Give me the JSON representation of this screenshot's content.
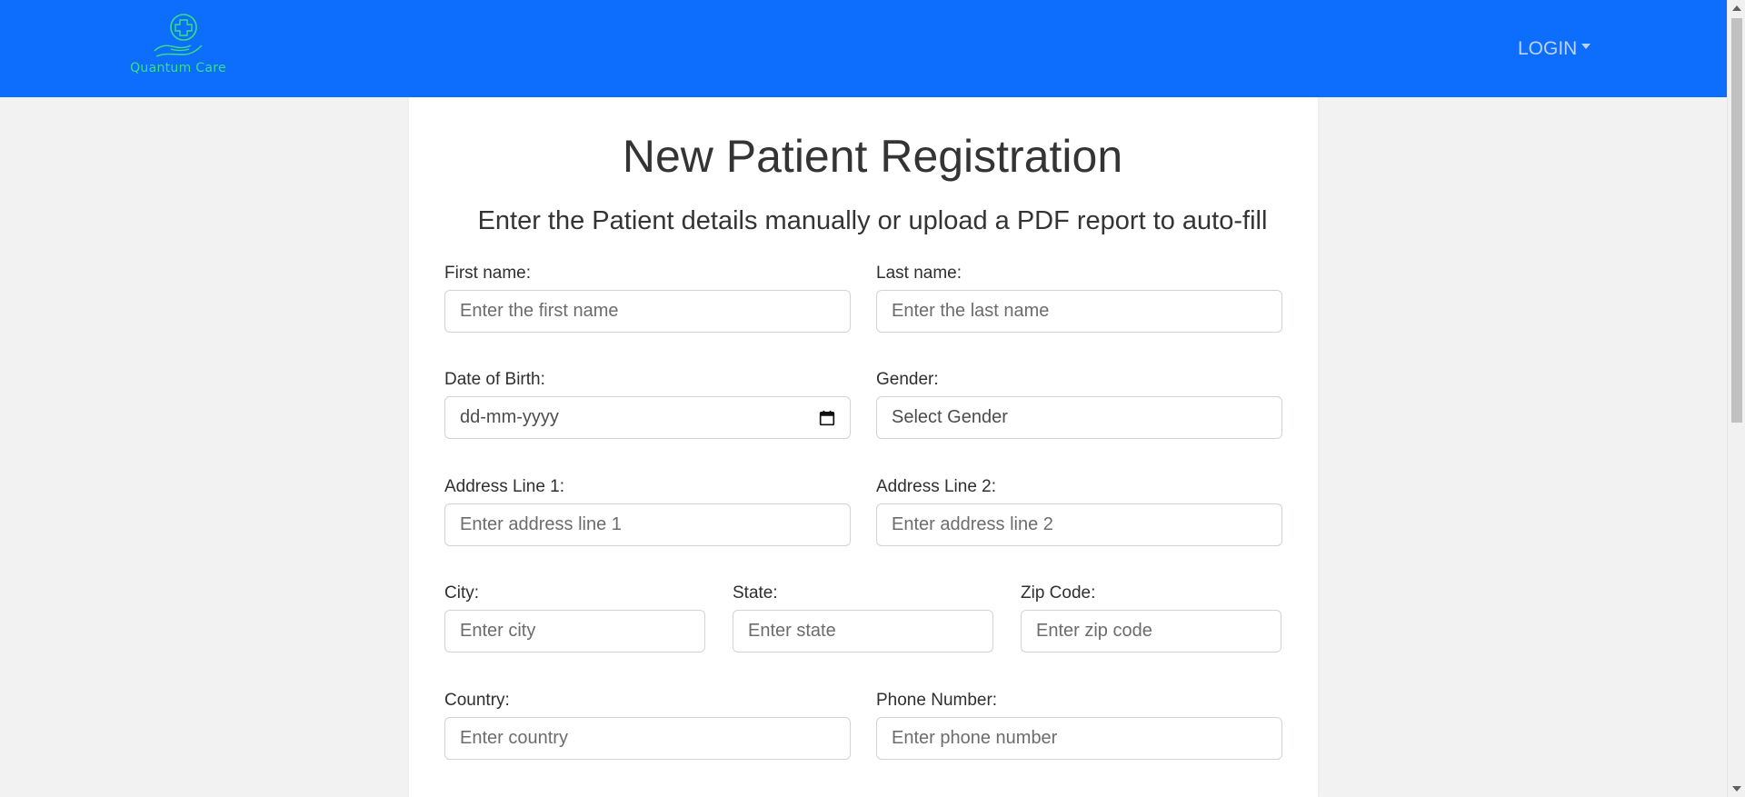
{
  "navbar": {
    "brand_name": "Quantum Care",
    "logo_icon": "hand-with-medical-cross-icon",
    "login_label": "LOGIN",
    "colors": {
      "background": "#0d6efd",
      "brand_text": "#39e07c"
    }
  },
  "page": {
    "title": "New Patient Registration",
    "subtitle": "Enter the Patient details manually or upload a PDF report to auto-fill"
  },
  "form": {
    "first_name": {
      "label": "First name:",
      "placeholder": "Enter the first name"
    },
    "last_name": {
      "label": "Last name:",
      "placeholder": "Enter the last name"
    },
    "dob": {
      "label": "Date of Birth:",
      "placeholder": "dd-mm-yyyy",
      "icon": "calendar-icon"
    },
    "gender": {
      "label": "Gender:",
      "selected": "Select Gender"
    },
    "address1": {
      "label": "Address Line 1:",
      "placeholder": "Enter address line 1"
    },
    "address2": {
      "label": "Address Line 2:",
      "placeholder": "Enter address line 2"
    },
    "city": {
      "label": "City:",
      "placeholder": "Enter city"
    },
    "state": {
      "label": "State:",
      "placeholder": "Enter state"
    },
    "zip": {
      "label": "Zip Code:",
      "placeholder": "Enter zip code"
    },
    "country": {
      "label": "Country:",
      "placeholder": "Enter country"
    },
    "phone": {
      "label": "Phone Number:",
      "placeholder": "Enter phone number"
    }
  }
}
